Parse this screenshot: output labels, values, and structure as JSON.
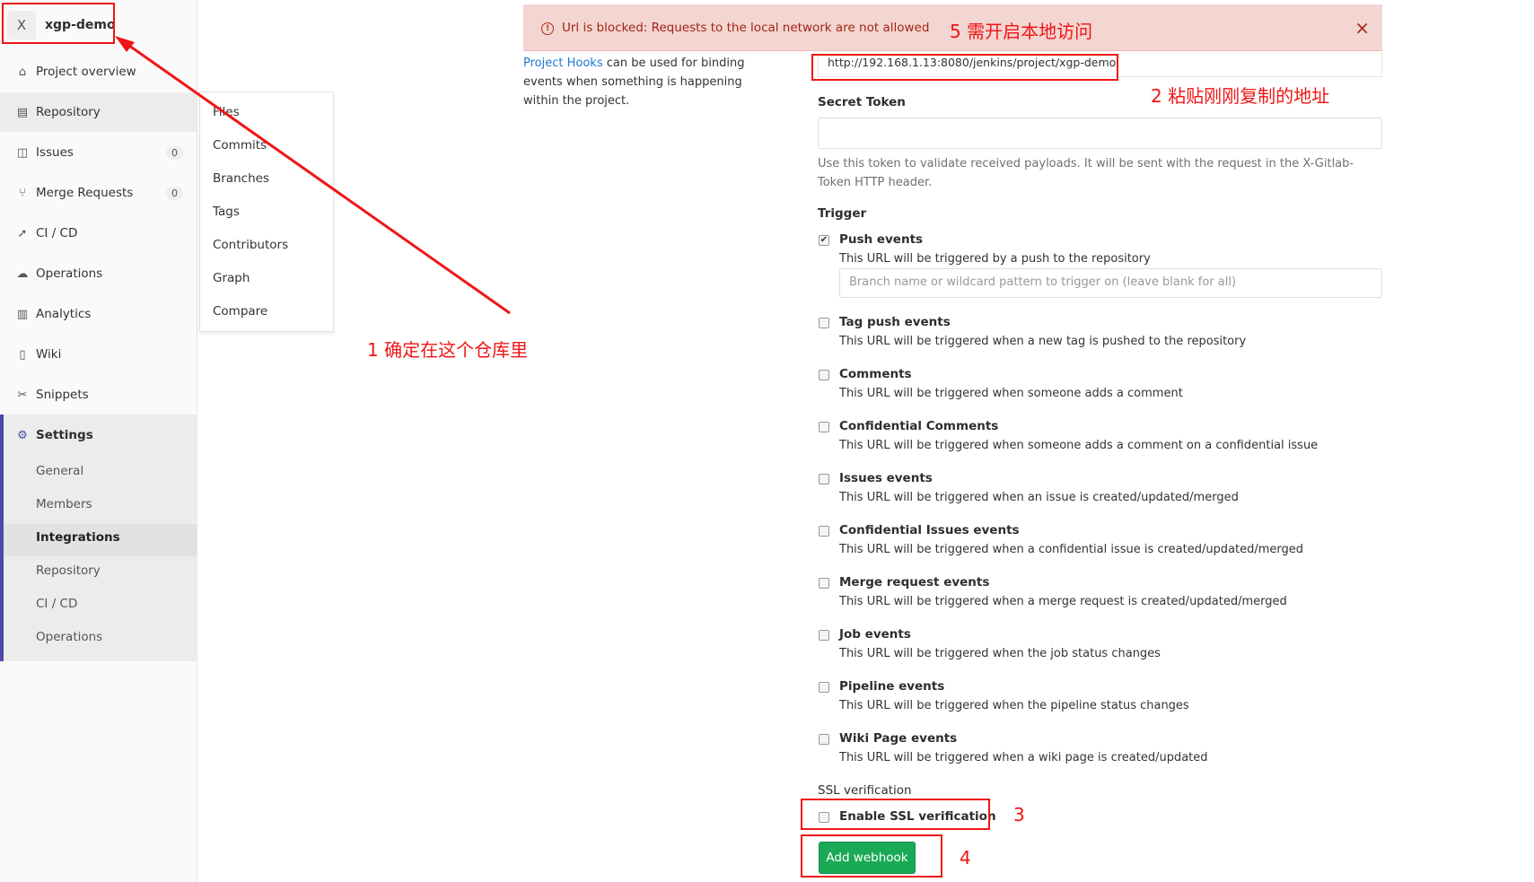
{
  "project": {
    "avatar_letter": "X",
    "name": "xgp-demo"
  },
  "sidebar": {
    "items": [
      {
        "label": "Project overview",
        "icon": "home-icon"
      },
      {
        "label": "Repository",
        "icon": "document-icon"
      },
      {
        "label": "Issues",
        "icon": "issues-icon",
        "badge": "0"
      },
      {
        "label": "Merge Requests",
        "icon": "merge-request-icon",
        "badge": "0"
      },
      {
        "label": "CI / CD",
        "icon": "rocket-icon"
      },
      {
        "label": "Operations",
        "icon": "cloud-gear-icon"
      },
      {
        "label": "Analytics",
        "icon": "chart-icon"
      },
      {
        "label": "Wiki",
        "icon": "book-icon"
      },
      {
        "label": "Snippets",
        "icon": "scissors-icon"
      },
      {
        "label": "Settings",
        "icon": "gear-icon"
      }
    ],
    "settings_sub": [
      "General",
      "Members",
      "Integrations",
      "Repository",
      "CI / CD",
      "Operations"
    ]
  },
  "repo_flyout": [
    "Files",
    "Commits",
    "Branches",
    "Tags",
    "Contributors",
    "Graph",
    "Compare"
  ],
  "alert": {
    "text": "Url is blocked: Requests to the local network are not allowed",
    "close": "×"
  },
  "intro": {
    "link": "Project Hooks",
    "text": " can be used for binding events when something is happening within the project."
  },
  "form": {
    "url_value": "http://192.168.1.13:8080/jenkins/project/xgp-demo",
    "secret_label": "Secret Token",
    "secret_help": "Use this token to validate received payloads. It will be sent with the request in the X-Gitlab-Token HTTP header.",
    "trigger_label": "Trigger",
    "branch_placeholder": "Branch name or wildcard pattern to trigger on (leave blank for all)",
    "events": [
      {
        "title": "Push events",
        "desc": "This URL will be triggered by a push to the repository",
        "checked": true
      },
      {
        "title": "Tag push events",
        "desc": "This URL will be triggered when a new tag is pushed to the repository",
        "checked": false
      },
      {
        "title": "Comments",
        "desc": "This URL will be triggered when someone adds a comment",
        "checked": false
      },
      {
        "title": "Confidential Comments",
        "desc": "This URL will be triggered when someone adds a comment on a confidential issue",
        "checked": false
      },
      {
        "title": "Issues events",
        "desc": "This URL will be triggered when an issue is created/updated/merged",
        "checked": false
      },
      {
        "title": "Confidential Issues events",
        "desc": "This URL will be triggered when a confidential issue is created/updated/merged",
        "checked": false
      },
      {
        "title": "Merge request events",
        "desc": "This URL will be triggered when a merge request is created/updated/merged",
        "checked": false
      },
      {
        "title": "Job events",
        "desc": "This URL will be triggered when the job status changes",
        "checked": false
      },
      {
        "title": "Pipeline events",
        "desc": "This URL will be triggered when the pipeline status changes",
        "checked": false
      },
      {
        "title": "Wiki Page events",
        "desc": "This URL will be triggered when a wiki page is created/updated",
        "checked": false
      }
    ],
    "ssl_label": "SSL verification",
    "ssl_checkbox": "Enable SSL verification",
    "submit": "Add webhook"
  },
  "annotations": {
    "a1": "1 确定在这个仓库里",
    "a2": "2 粘贴刚刚复制的地址",
    "a3": "3",
    "a4": "4",
    "a5": "5 需开启本地访问"
  },
  "colors": {
    "annotation_red": "#f01515",
    "alert_bg": "#f3d5d1",
    "button_green": "#1aaa55",
    "settings_accent": "#4b4ba3"
  }
}
